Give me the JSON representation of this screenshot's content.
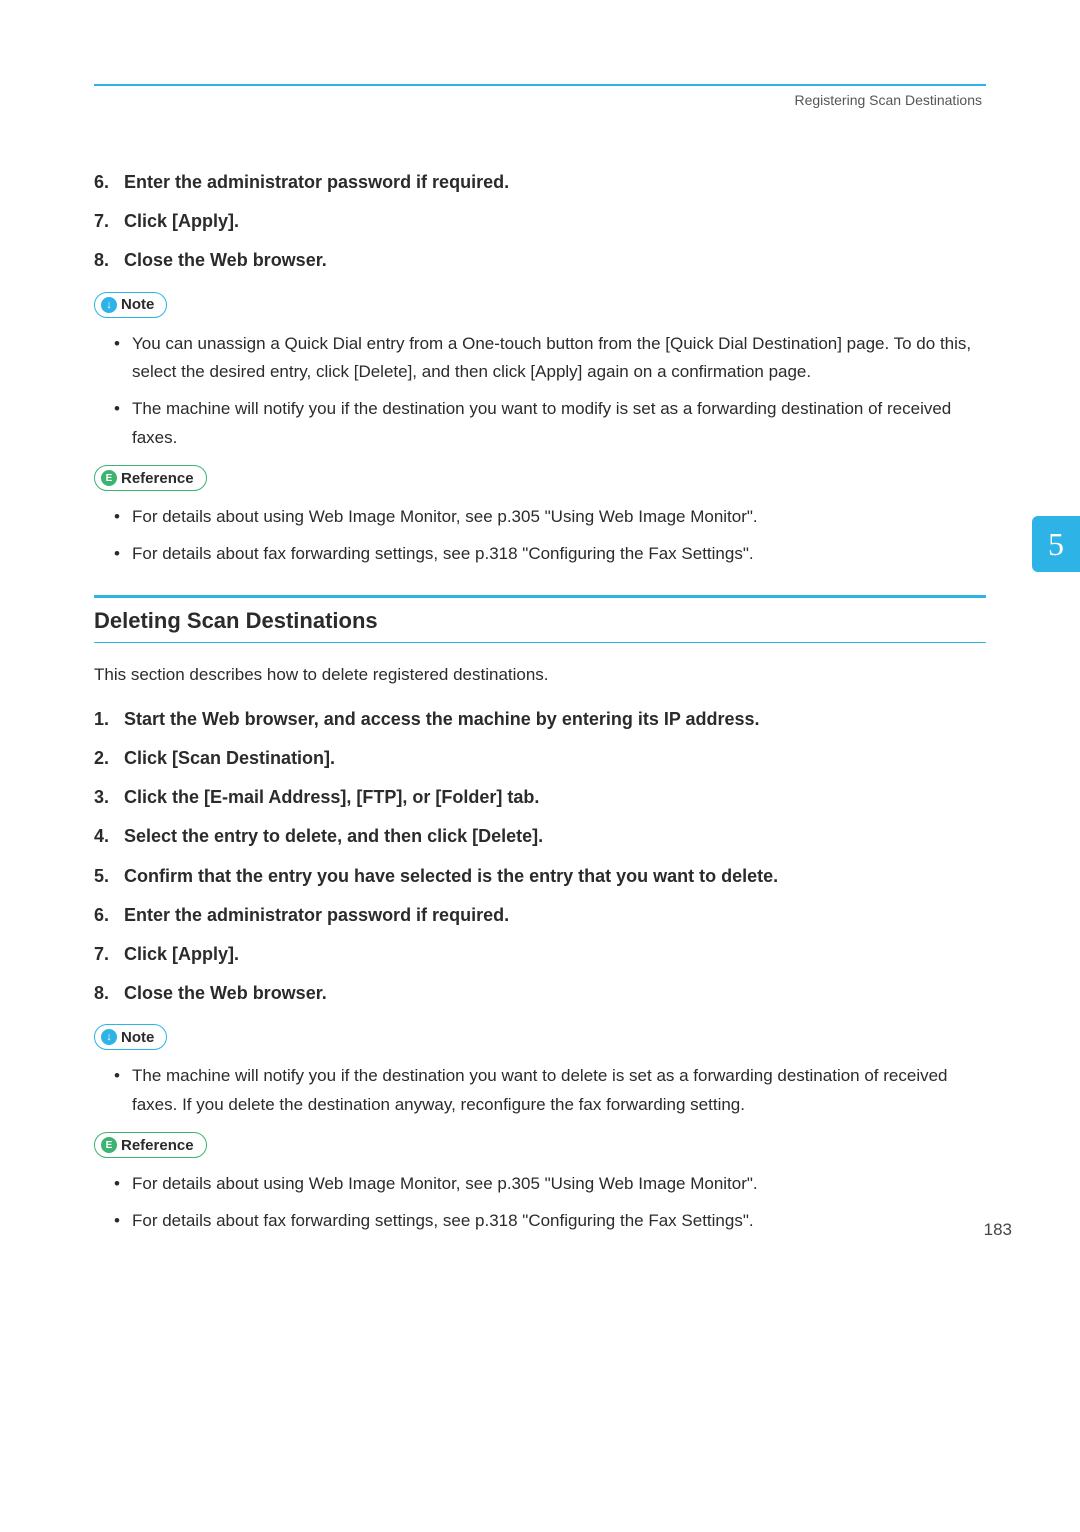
{
  "header": {
    "section_label": "Registering Scan Destinations"
  },
  "side_tab": {
    "number": "5"
  },
  "first_list": {
    "items": [
      {
        "num": "6.",
        "txt": "Enter the administrator password if required."
      },
      {
        "num": "7.",
        "txt": "Click [Apply]."
      },
      {
        "num": "8.",
        "txt": "Close the Web browser."
      }
    ]
  },
  "labels": {
    "note": "Note",
    "reference": "Reference"
  },
  "note1": {
    "bullets": [
      "You can unassign a Quick Dial entry from a One-touch button from the [Quick Dial Destination] page. To do this, select the desired entry, click [Delete], and then click [Apply] again on a confirmation page.",
      "The machine will notify you if the destination you want to modify is set as a forwarding destination of received faxes."
    ]
  },
  "ref1": {
    "bullets": [
      "For details about using Web Image Monitor, see p.305 \"Using Web Image Monitor\".",
      "For details about fax forwarding settings, see p.318 \"Configuring the Fax Settings\"."
    ]
  },
  "section2": {
    "heading": "Deleting Scan Destinations",
    "intro": "This section describes how to delete registered destinations.",
    "items": [
      {
        "num": "1.",
        "txt": "Start the Web browser, and access the machine by entering its IP address."
      },
      {
        "num": "2.",
        "txt": "Click [Scan Destination]."
      },
      {
        "num": "3.",
        "txt": "Click the [E-mail Address], [FTP], or [Folder] tab."
      },
      {
        "num": "4.",
        "txt": "Select the entry to delete, and then click [Delete]."
      },
      {
        "num": "5.",
        "txt": "Confirm that the entry you have selected is the entry that you want to delete."
      },
      {
        "num": "6.",
        "txt": "Enter the administrator password if required."
      },
      {
        "num": "7.",
        "txt": "Click [Apply]."
      },
      {
        "num": "8.",
        "txt": "Close the Web browser."
      }
    ]
  },
  "note2": {
    "bullets": [
      "The machine will notify you if the destination you want to delete is set as a forwarding destination of received faxes. If you delete the destination anyway, reconfigure the fax forwarding setting."
    ]
  },
  "ref2": {
    "bullets": [
      "For details about using Web Image Monitor, see p.305 \"Using Web Image Monitor\".",
      "For details about fax forwarding settings, see p.318 \"Configuring the Fax Settings\"."
    ]
  },
  "page_number": "183"
}
